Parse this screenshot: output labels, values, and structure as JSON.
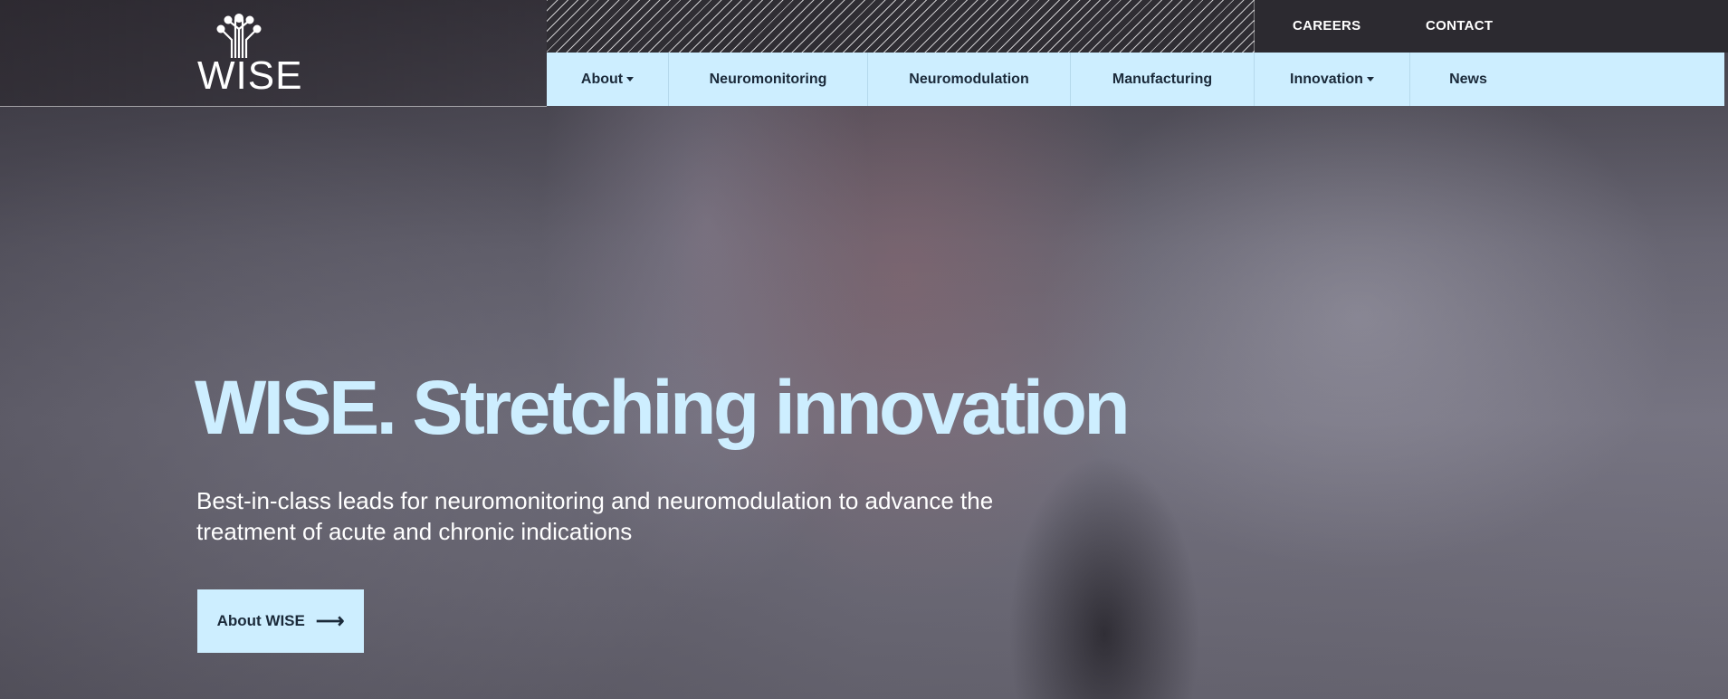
{
  "brand": {
    "logo_text": "WISE",
    "accent": "#cdeeff"
  },
  "topbar": {
    "careers": "CAREERS",
    "contact": "CONTACT"
  },
  "nav": {
    "items": [
      {
        "label": "About",
        "dropdown": true
      },
      {
        "label": "Neuromonitoring",
        "dropdown": false
      },
      {
        "label": "Neuromodulation",
        "dropdown": false
      },
      {
        "label": "Manufacturing",
        "dropdown": false
      },
      {
        "label": "Innovation",
        "dropdown": true
      },
      {
        "label": "News",
        "dropdown": false
      }
    ]
  },
  "hero": {
    "title": "WISE. Stretching innovation",
    "subtitle": "Best-in-class leads for neuromonitoring and neuromodulation to advance the treatment of acute and chronic indications",
    "button_label": "About WISE",
    "button_icon": "arrow-right-icon"
  }
}
